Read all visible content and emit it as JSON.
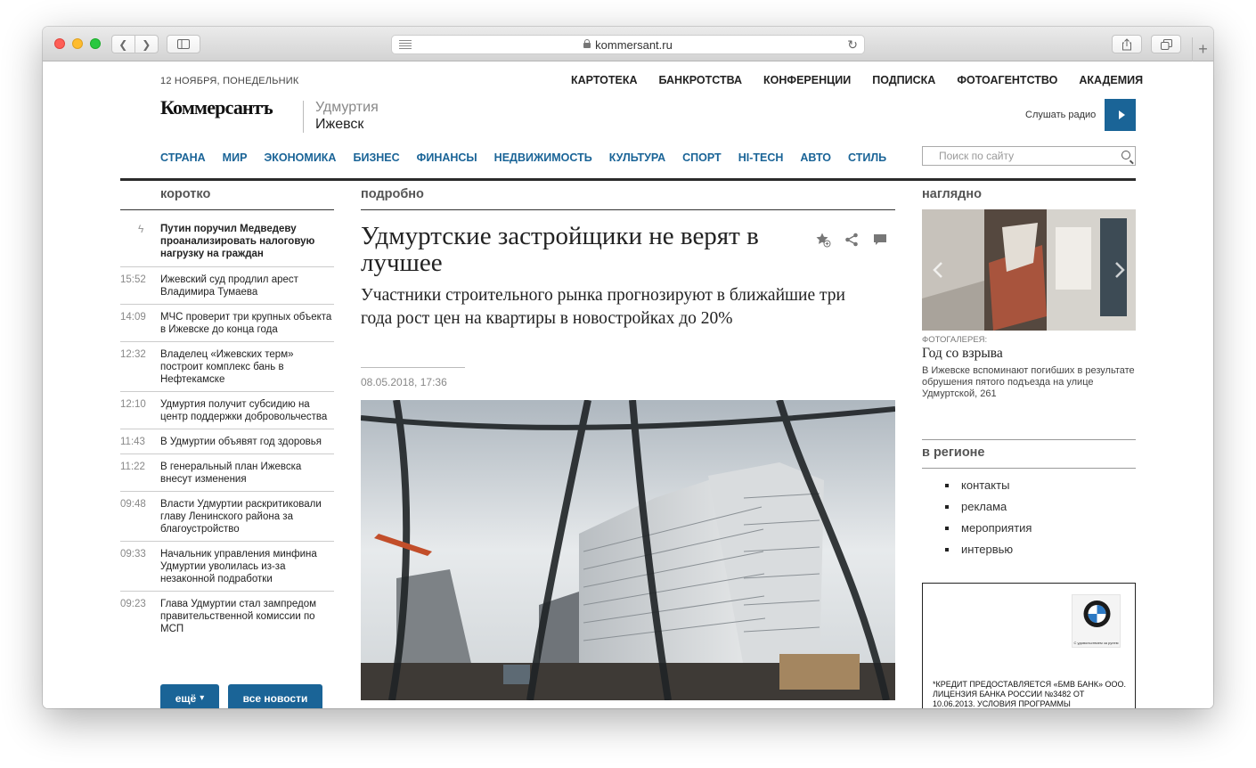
{
  "browser": {
    "url": "kommersant.ru"
  },
  "header": {
    "date": "12 НОЯБРЯ, ПОНЕДЕЛЬНИК",
    "top_nav": [
      "КАРТОТЕКА",
      "БАНКРОТСТВА",
      "КОНФЕРЕНЦИИ",
      "ПОДПИСКА",
      "ФОТОАГЕНТСТВО",
      "АКАДЕМИЯ"
    ],
    "logo": "Коммерсантъ",
    "region_line1": "Удмуртия",
    "region_line2": "Ижевск",
    "radio_label": "Слушать радио",
    "rubrics": [
      "СТРАНА",
      "МИР",
      "ЭКОНОМИКА",
      "БИЗНЕС",
      "ФИНАНСЫ",
      "НЕДВИЖИМОСТЬ",
      "КУЛЬТУРА",
      "СПОРТ",
      "HI-TECH",
      "АВТО",
      "СТИЛЬ"
    ],
    "search_placeholder": "Поиск по сайту"
  },
  "left": {
    "heading": "коротко",
    "news": [
      {
        "time": "",
        "headline": "Путин поручил Медведеву проанализировать налоговую нагрузку на граждан"
      },
      {
        "time": "15:52",
        "headline": "Ижевский суд продлил арест Владимира Тумаева"
      },
      {
        "time": "14:09",
        "headline": "МЧС проверит три крупных объекта в Ижевске до конца года"
      },
      {
        "time": "12:32",
        "headline": "Владелец «Ижевских терм» построит комплекс бань в Нефтекамске"
      },
      {
        "time": "12:10",
        "headline": "Удмуртия получит субсидию на центр поддержки добровольчества"
      },
      {
        "time": "11:43",
        "headline": "В Удмуртии объявят год здоровья"
      },
      {
        "time": "11:22",
        "headline": "В генеральный план Ижевска внесут изменения"
      },
      {
        "time": "09:48",
        "headline": "Власти Удмуртии раскритиковали главу Ленинского района за благоустройство"
      },
      {
        "time": "09:33",
        "headline": "Начальник управления минфина Удмуртии уволилась из-за незаконной подработки"
      },
      {
        "time": "09:23",
        "headline": "Глава Удмуртии стал зампредом правительственной комиссии по МСП"
      }
    ],
    "more_label": "ещё",
    "all_news_label": "все новости"
  },
  "center": {
    "heading": "подробно",
    "title": "Удмуртские застройщики не верят в лучшее",
    "subtitle": "Участники строительного рынка прогнозируют в ближайшие три года рост цен на квартиры в новостройках до 20%",
    "date": "08.05.2018, 17:36"
  },
  "right": {
    "heading": "наглядно",
    "gallery_label": "ФОТОГАЛЕРЕЯ:",
    "gallery_title": "Год со взрыва",
    "gallery_desc": "В Ижевске вспоминают погибших в результате обрушения пятого подъезда на улице Удмуртской, 261",
    "region_heading": "в регионе",
    "region_links": [
      "контакты",
      "реклама",
      "мероприятия",
      "интервью"
    ],
    "ad_logo_caption": "С удовольствием за рулем",
    "ad_text": "*КРЕДИТ ПРЕДОСТАВЛЯЕТСЯ «БМВ БАНК» ООО. ЛИЦЕНЗИЯ БАНКА РОССИИ №3482 ОТ 10.06.2013. УСЛОВИЯ ПРОГРАММЫ КРЕДИТОВАНИЯ «ЖАЖДА ПРАВА»"
  },
  "colors": {
    "brand_blue": "#1a6497"
  }
}
